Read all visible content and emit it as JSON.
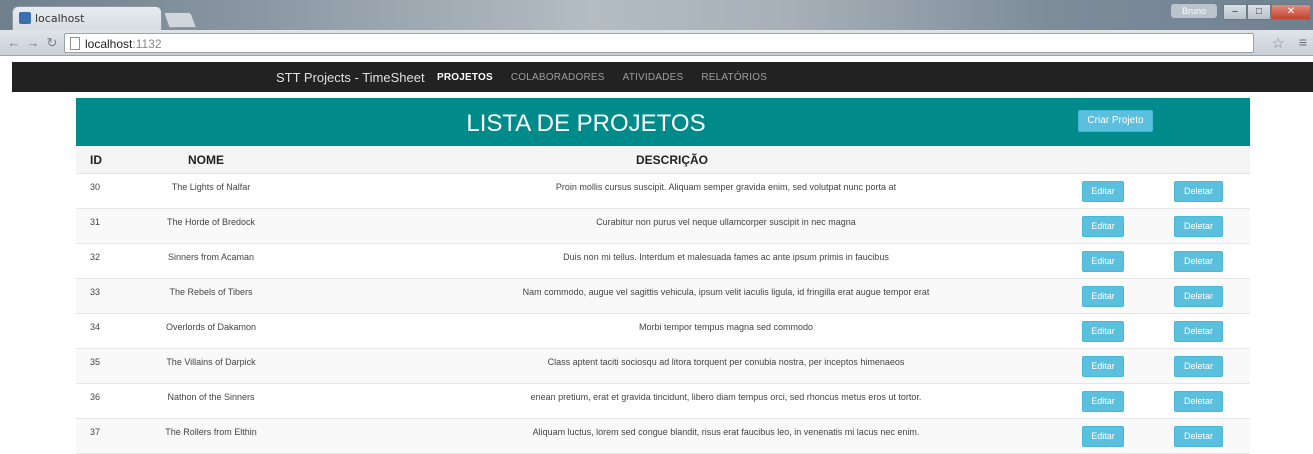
{
  "browser": {
    "tab_title": "localhost",
    "url_host": "localhost",
    "url_port": ":1132",
    "user_badge": "Bruno"
  },
  "navbar": {
    "brand": "STT Projects - TimeSheet",
    "links": [
      "PROJETOS",
      "COLABORADORES",
      "ATIVIDADES",
      "RELATÓRIOS"
    ]
  },
  "header": {
    "title": "LISTA DE PROJETOS",
    "create_button": "Criar Projeto"
  },
  "table": {
    "columns": [
      "ID",
      "NOME",
      "DESCRIÇÃO"
    ],
    "edit_label": "Editar",
    "delete_label": "Deletar",
    "rows": [
      {
        "id": "30",
        "nome": "The Lights of Nalfar",
        "descricao": "Proin mollis cursus suscipit. Aliquam semper gravida enim, sed volutpat nunc porta at"
      },
      {
        "id": "31",
        "nome": "The Horde of Bredock",
        "descricao": "Curabitur non purus vel neque ullamcorper suscipit in nec magna"
      },
      {
        "id": "32",
        "nome": "Sinners from Acaman",
        "descricao": "Duis non mi tellus. Interdum et malesuada fames ac ante ipsum primis in faucibus"
      },
      {
        "id": "33",
        "nome": "The Rebels of Tibers",
        "descricao": "Nam commodo, augue vel sagittis vehicula, ipsum velit iaculis ligula, id fringilla erat augue tempor erat"
      },
      {
        "id": "34",
        "nome": "Overlords of Dakamon",
        "descricao": "Morbi tempor tempus magna sed commodo"
      },
      {
        "id": "35",
        "nome": "The Villains of Darpick",
        "descricao": "Class aptent taciti sociosqu ad litora torquent per conubia nostra, per inceptos himenaeos"
      },
      {
        "id": "36",
        "nome": "Nathon of the Sinners",
        "descricao": "enean pretium, erat et gravida tincidunt, libero diam tempus orci, sed rhoncus metus eros ut tortor."
      },
      {
        "id": "37",
        "nome": "The Rollers from Elthin",
        "descricao": "Aliquam luctus, lorem sed congue blandit, risus erat faucibus leo, in venenatis mi lacus nec enim."
      }
    ]
  }
}
